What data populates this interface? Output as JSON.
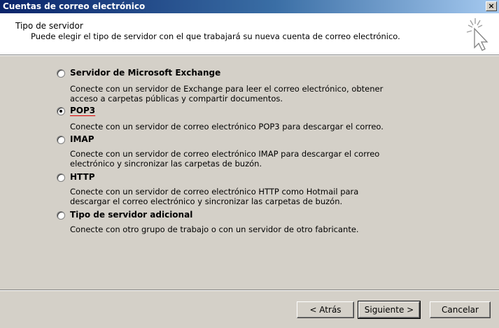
{
  "window": {
    "title": "Cuentas de correo electrónico",
    "close_label": "×"
  },
  "header": {
    "title": "Tipo de servidor",
    "subtitle": "Puede elegir el tipo de servidor con el que trabajará su nueva cuenta de correo electrónico.",
    "icon": "wizard-sparkle-cursor-icon"
  },
  "options": [
    {
      "label": "Servidor de Microsoft Exchange",
      "description": "Conecte con un servidor de Exchange para leer el correo electrónico, obtener acceso a carpetas públicas y compartir documentos.",
      "selected": false
    },
    {
      "label": "POP3",
      "description": "Conecte con un servidor de correo electrónico POP3 para descargar el correo.",
      "selected": true
    },
    {
      "label": "IMAP",
      "description": "Conecte con un servidor de correo electrónico IMAP para descargar el correo electrónico y sincronizar las carpetas de buzón.",
      "selected": false
    },
    {
      "label": "HTTP",
      "description": "Conecte con un servidor de correo electrónico HTTP como Hotmail para descargar el correo electrónico y sincronizar las carpetas de buzón.",
      "selected": false
    },
    {
      "label": "Tipo de servidor adicional",
      "description": "Conecte con otro grupo de trabajo o con un servidor de otro fabricante.",
      "selected": false
    }
  ],
  "buttons": {
    "back": "< Atrás",
    "next": "Siguiente >",
    "cancel": "Cancelar"
  },
  "colors": {
    "titlebar_start": "#0a246a",
    "titlebar_end": "#a6caf0",
    "dialog_bg": "#d4d0c8",
    "annotation_underline": "#e00000"
  }
}
